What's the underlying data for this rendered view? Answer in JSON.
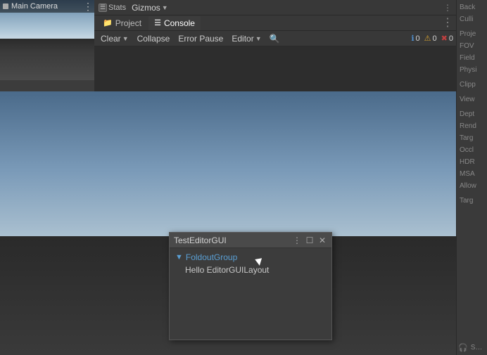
{
  "camera": {
    "title": "Main Camera",
    "more_icon": "⋮"
  },
  "stats_bar": {
    "stats_label": "Stats",
    "gizmos_label": "Gizmos",
    "gizmos_arrow": "▼"
  },
  "tabs": {
    "project_label": "Project",
    "console_label": "Console",
    "project_icon": "📁",
    "console_icon": "☰",
    "more_icon": "⋮"
  },
  "console_toolbar": {
    "clear_label": "Clear",
    "clear_arrow": "▼",
    "collapse_label": "Collapse",
    "error_pause_label": "Error Pause",
    "editor_label": "Editor",
    "editor_arrow": "▼",
    "search_icon": "🔍",
    "info_count": "0",
    "warn_count": "0",
    "error_count": "0",
    "info_icon": "ℹ",
    "warn_icon": "⚠",
    "error_icon": "✖"
  },
  "floating_window": {
    "title": "TestEditorGUI",
    "more_icon": "⋮",
    "maximize_icon": "☐",
    "close_icon": "✕",
    "foldout_arrow": "▼",
    "foldout_label": "FoldoutGroup",
    "content_text": "Hello EditorGUILayout"
  },
  "right_panel": {
    "items": [
      {
        "label": "Back"
      },
      {
        "label": "Culli"
      },
      {
        "label": ""
      },
      {
        "label": "Proje"
      },
      {
        "label": "FOV"
      },
      {
        "label": "Field"
      },
      {
        "label": "Physi"
      },
      {
        "label": ""
      },
      {
        "label": "Clipp"
      },
      {
        "label": ""
      },
      {
        "label": "View"
      },
      {
        "label": ""
      },
      {
        "label": "Dept"
      },
      {
        "label": "Rend"
      },
      {
        "label": "Targ"
      },
      {
        "label": "Occl"
      },
      {
        "label": "HDR"
      },
      {
        "label": "MSA"
      },
      {
        "label": "Allow"
      },
      {
        "label": ""
      },
      {
        "label": "Targ"
      },
      {
        "label": ""
      },
      {
        "label": "Scrip"
      }
    ]
  }
}
